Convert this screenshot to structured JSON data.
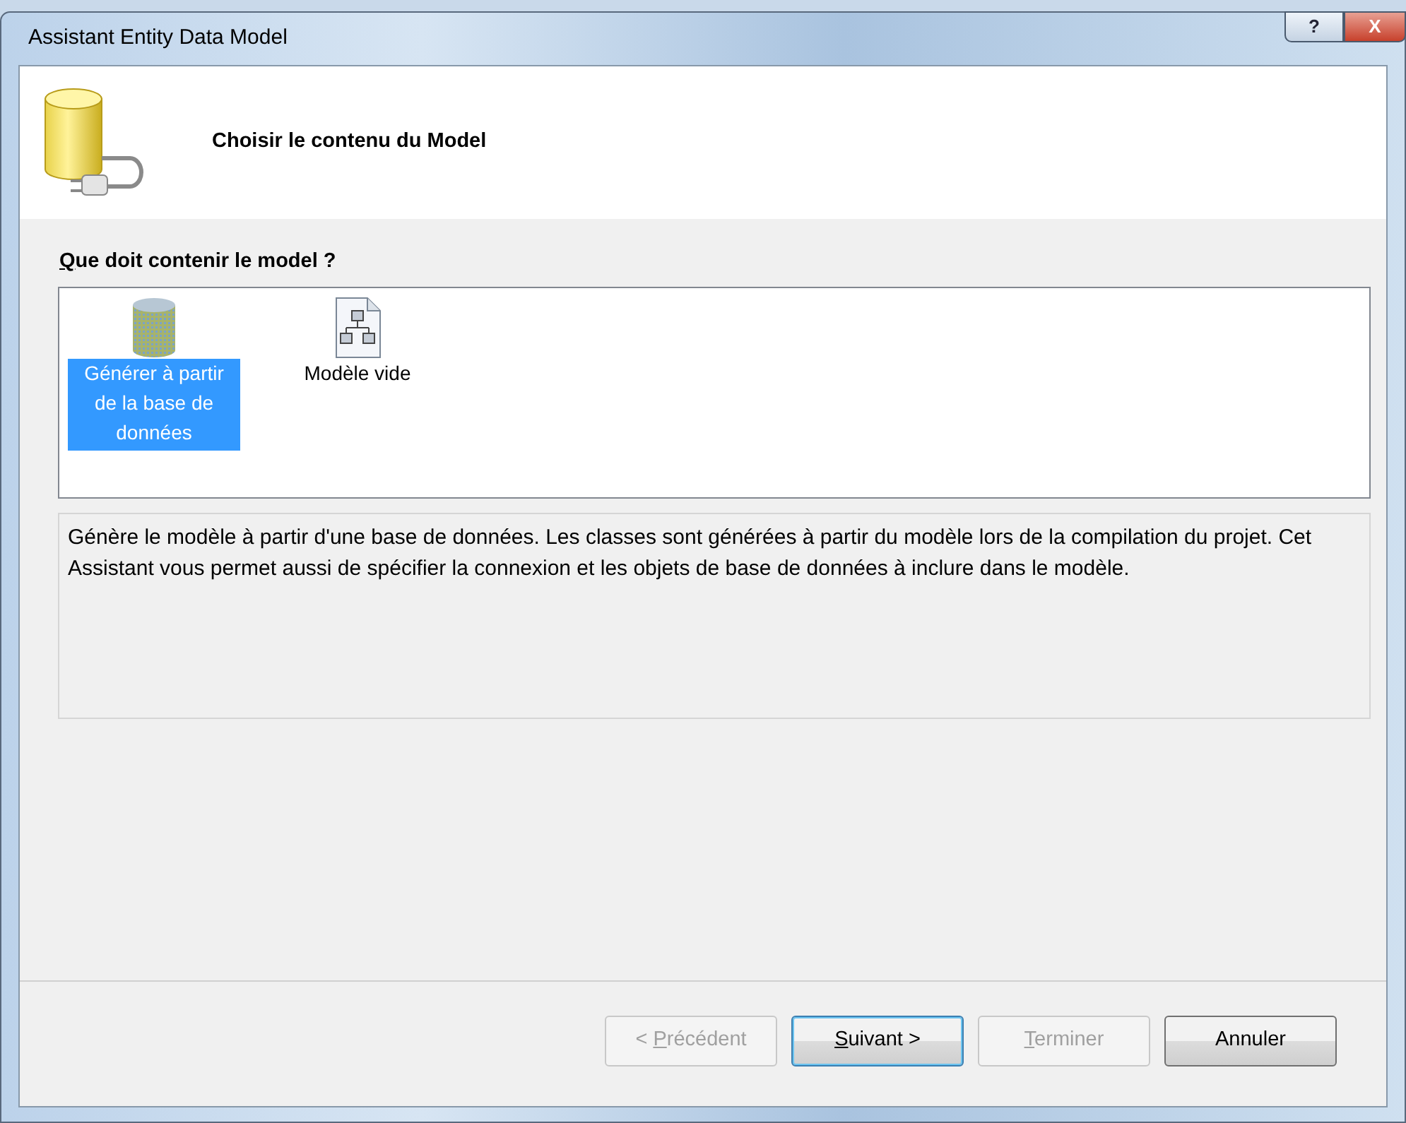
{
  "window": {
    "title": "Assistant Entity Data Model",
    "caption_buttons": [
      {
        "kind": "help",
        "label": "?"
      },
      {
        "kind": "close",
        "label": "X"
      }
    ]
  },
  "header": {
    "title": "Choisir le contenu du Model"
  },
  "question": {
    "access_key": "Q",
    "text_after": "ue doit contenir le model ?"
  },
  "options": [
    {
      "kind": "database",
      "label": "Générer à partir de la base de données",
      "selected": true
    },
    {
      "kind": "diagram",
      "label": "Modèle vide",
      "selected": false
    }
  ],
  "description": "Génère le modèle à partir d'une base de données. Les classes sont générées à partir du modèle lors de la compilation du projet. Cet Assistant vous permet aussi de spécifier la connexion et les objets de base de données à inclure dans le modèle.",
  "buttons": [
    {
      "text_before": "< ",
      "access_key": "P",
      "text_after": "récédent",
      "disabled": true,
      "default": false
    },
    {
      "access_key": "S",
      "text_after": "uivant >",
      "disabled": false,
      "default": true
    },
    {
      "access_key": "T",
      "text_after": "erminer",
      "disabled": true,
      "default": false
    },
    {
      "text_before": "Annuler",
      "disabled": false,
      "default": false
    }
  ]
}
